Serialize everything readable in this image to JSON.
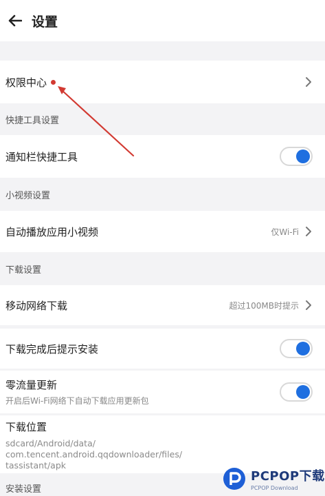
{
  "header": {
    "title": "设置",
    "back_icon": "arrow-left-icon"
  },
  "permission_row": {
    "label": "权限中心"
  },
  "sections": {
    "shortcut": "快捷工具设置",
    "video": "小视频设置",
    "download": "下载设置",
    "install": "安装设置"
  },
  "shortcut_row": {
    "label": "通知栏快捷工具",
    "enabled": true
  },
  "video_row": {
    "label": "自动播放应用小视频",
    "value": "仅Wi-Fi"
  },
  "mobile_download_row": {
    "label": "移动网络下载",
    "value": "超过100MB时提示"
  },
  "install_prompt_row": {
    "label": "下载完成后提示安装",
    "enabled": true
  },
  "zero_traffic_row": {
    "label": "零流量更新",
    "sub": "开启后Wi-Fi网络下自动下载应用更新包",
    "enabled": true
  },
  "download_location_row": {
    "label": "下载位置",
    "path_lines": [
      "sdcard/Android/data/",
      "com.tencent.android.qqdownloader/files/",
      "tassistant/apk"
    ]
  },
  "watermark": {
    "main": "PCPOP下载",
    "sub": "PCPOP Download"
  },
  "colors": {
    "accent": "#1f6fe0",
    "annotation": "#d23a32",
    "background": "#f3f3f5"
  }
}
